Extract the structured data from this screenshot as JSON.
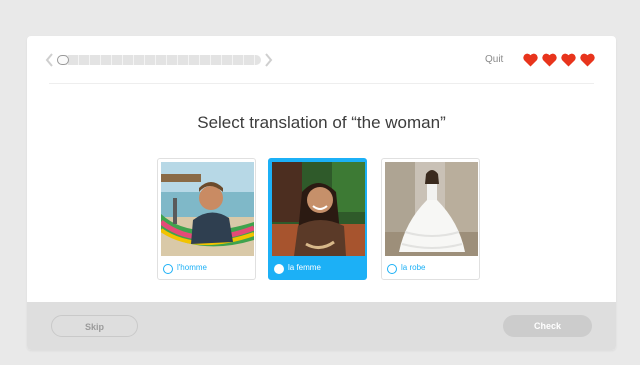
{
  "header": {
    "progress_fraction": 0.06,
    "quit_label": "Quit",
    "hearts_count": 4,
    "heart_color": "#e8341c"
  },
  "prompt": "Select translation of “the woman”",
  "choices": [
    {
      "label": "l'homme",
      "image": "man-in-hammock-photo",
      "selected": false
    },
    {
      "label": "la femme",
      "image": "smiling-woman-photo",
      "selected": true
    },
    {
      "label": "la robe",
      "image": "white-dress-photo",
      "selected": false
    }
  ],
  "footer": {
    "skip_label": "Skip",
    "check_label": "Check"
  },
  "colors": {
    "accent": "#1cb0f6",
    "page_bg": "#e9e9e9",
    "footer_bg": "#dedede"
  }
}
